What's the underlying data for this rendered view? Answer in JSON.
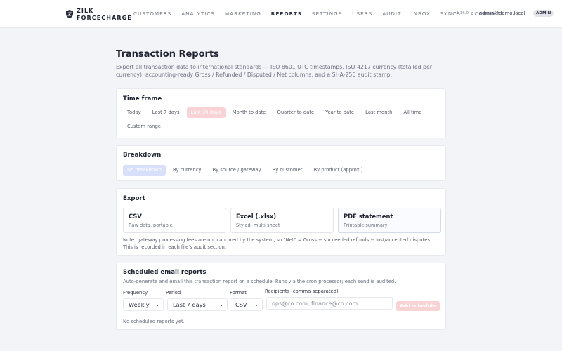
{
  "brand": {
    "line1": "ZILK",
    "line2": "FORCECHARGE"
  },
  "nav": {
    "items": [
      "CUSTOMERS",
      "ANALYTICS",
      "MARKETING",
      "REPORTS",
      "SETTINGS",
      "USERS",
      "AUDIT",
      "INBOX",
      "SYNCS",
      "ACCOUNT"
    ],
    "active": "REPORTS"
  },
  "header": {
    "version": "v2.16.0",
    "email": "admin@demo.local",
    "role": "ADMIN"
  },
  "page": {
    "title": "Transaction Reports",
    "description": "Export all transaction data to international standards — ISO 8601 UTC timestamps, ISO 4217 currency (totalled per currency), accounting-ready Gross / Refunded / Disputed / Net columns, and a SHA-256 audit stamp."
  },
  "timeframe": {
    "title": "Time frame",
    "options": [
      "Today",
      "Last 7 days",
      "Last 30 days",
      "Month to date",
      "Quarter to date",
      "Year to date",
      "Last month",
      "All time",
      "Custom range"
    ],
    "selected": "Last 30 days"
  },
  "breakdown": {
    "title": "Breakdown",
    "options": [
      "No breakdown",
      "By currency",
      "By source / gateway",
      "By customer",
      "By product (approx.)"
    ],
    "selected": "No breakdown"
  },
  "export": {
    "title": "Export",
    "options": [
      {
        "title": "CSV",
        "subtitle": "Raw data, portable"
      },
      {
        "title": "Excel (.xlsx)",
        "subtitle": "Styled, multi-sheet"
      },
      {
        "title": "PDF statement",
        "subtitle": "Printable summary"
      }
    ],
    "note": "Note: gateway processing fees are not captured by the system, so \"Net\" = Gross − succeeded refunds − lost/accepted disputes. This is recorded in each file's audit section."
  },
  "scheduled": {
    "title": "Scheduled email reports",
    "description": "Auto-generate and email this transaction report on a schedule. Runs via the cron processor; each send is audited.",
    "frequency_label": "Frequency",
    "frequency_value": "Weekly",
    "period_label": "Period",
    "period_value": "Last 7 days",
    "format_label": "Format",
    "format_value": "CSV",
    "recipients_label": "Recipients (comma-separated)",
    "recipients_placeholder": "ops@co.com, finance@co.com",
    "add_label": "Add schedule",
    "empty_text": "No scheduled reports yet."
  },
  "colors": {
    "accent_pink": "#f8d2d5",
    "accent_blue": "#d8dff8",
    "brand_red": "#b3262e"
  },
  "icons": {
    "brand": "shield-logo-icon",
    "dropdown": "chevron-down-icon"
  }
}
